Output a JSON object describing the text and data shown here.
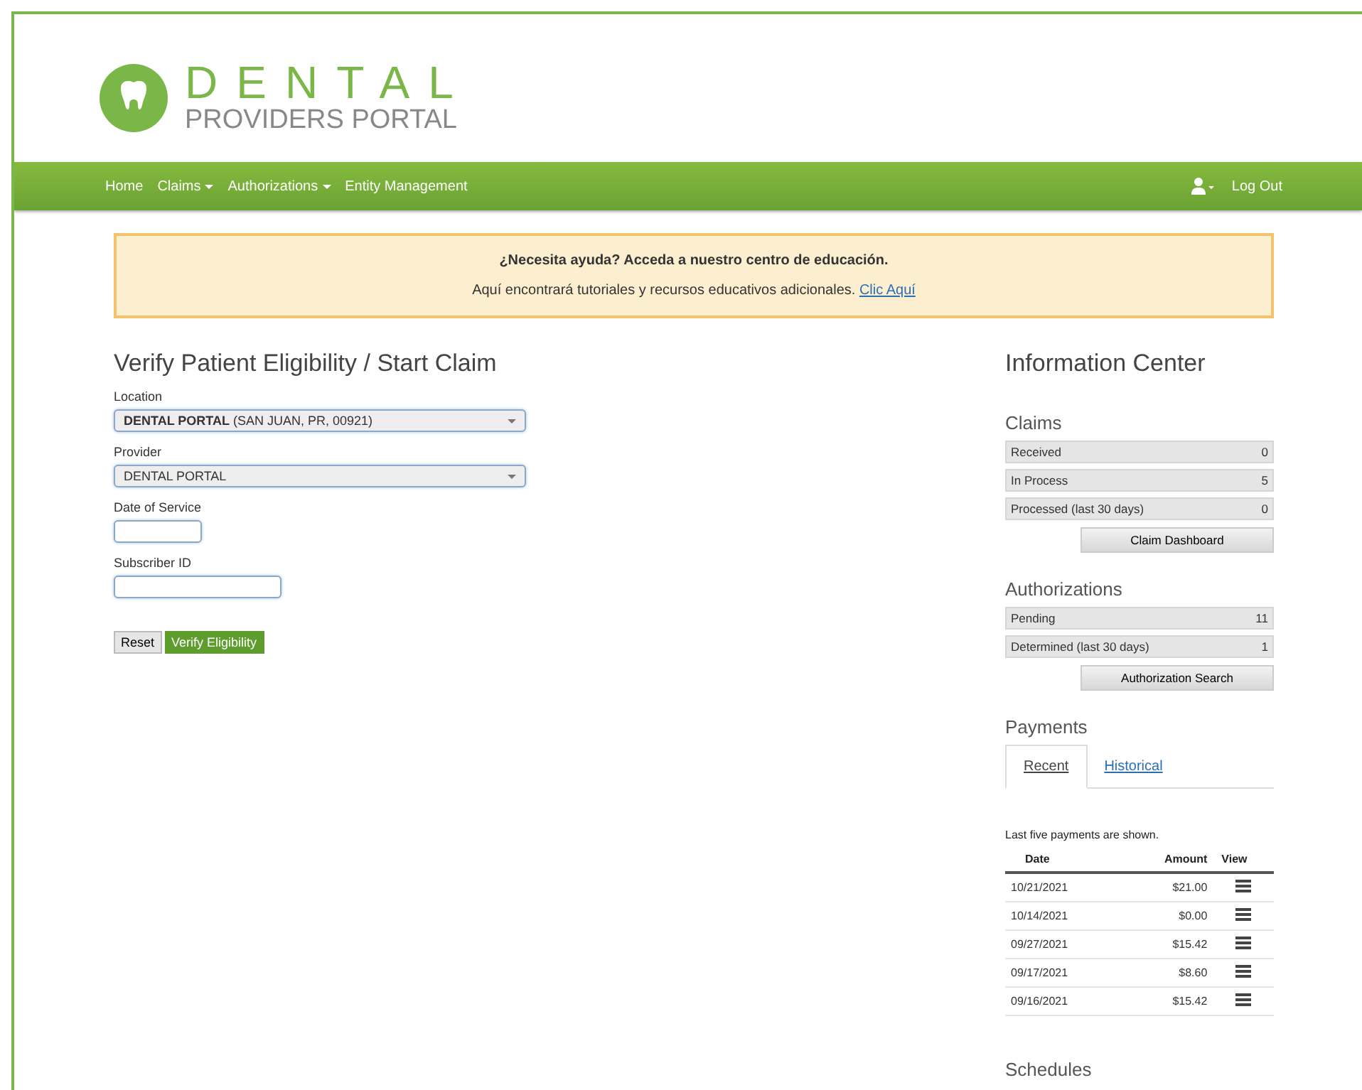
{
  "logo": {
    "word": "DENTAL",
    "subtitle": "PROVIDERS PORTAL"
  },
  "nav": {
    "items": [
      {
        "label": "Home",
        "has_menu": false
      },
      {
        "label": "Claims",
        "has_menu": true
      },
      {
        "label": "Authorizations",
        "has_menu": true
      },
      {
        "label": "Entity Management",
        "has_menu": false
      }
    ],
    "logout": "Log Out"
  },
  "alert": {
    "title": "¿Necesita ayuda? Acceda a nuestro centro de educación.",
    "text": "Aquí encontrará tutoriales y recursos educativos adicionales.",
    "link": "Clic Aquí"
  },
  "form": {
    "title": "Verify Patient Eligibility / Start Claim",
    "fields": [
      {
        "kind": "select",
        "label": "Location",
        "value": "**DENTAL PORTAL** (SAN JUAN, PR, 00921)"
      },
      {
        "kind": "select",
        "label": "Provider",
        "value": "DENTAL PORTAL"
      },
      {
        "kind": "short",
        "label": "Date of Service"
      },
      {
        "kind": "text",
        "label": "Subscriber ID"
      }
    ],
    "buttons": [
      {
        "label": "Reset",
        "primary": false
      },
      {
        "label": "Verify Eligibility",
        "primary": true
      }
    ]
  },
  "info": {
    "title": "Information Center",
    "claims": {
      "title": "Claims",
      "rows": [
        {
          "label": "Received",
          "count": "0"
        },
        {
          "label": "In Process",
          "count": "5"
        },
        {
          "label": "Processed (last 30 days)",
          "count": "0"
        }
      ],
      "button": "Claim Dashboard"
    },
    "authorizations": {
      "title": "Authorizations",
      "rows": [
        {
          "label": "Pending",
          "count": "11"
        },
        {
          "label": "Determined (last 30 days)",
          "count": "1"
        }
      ],
      "button": "Authorization Search"
    },
    "payments": {
      "title": "Payments",
      "tabs": [
        {
          "label": "Recent",
          "selected": true
        },
        {
          "label": "Historical",
          "selected": false
        }
      ],
      "note": "Last five payments are shown.",
      "columns": [
        "Date",
        "Amount",
        "View"
      ],
      "rows": [
        {
          "date": "10/21/2021",
          "amount": "$21.00"
        },
        {
          "date": "10/14/2021",
          "amount": "$0.00"
        },
        {
          "date": "09/27/2021",
          "amount": "$15.42"
        },
        {
          "date": "09/17/2021",
          "amount": "$8.60"
        },
        {
          "date": "09/16/2021",
          "amount": "$15.42"
        }
      ]
    },
    "schedules": {
      "title": "Schedules"
    }
  }
}
